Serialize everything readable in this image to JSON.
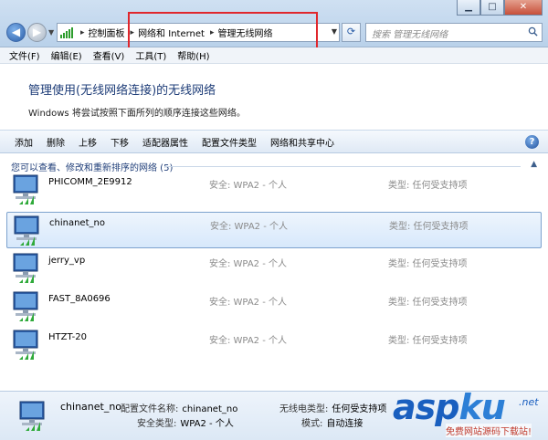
{
  "window": {
    "minimize": "▁",
    "maximize": "□",
    "close": "✕"
  },
  "address": {
    "crumbs": [
      "控制面板",
      "网络和 Internet",
      "管理无线网络"
    ],
    "search_placeholder": "搜索 管理无线网络"
  },
  "menu": {
    "items": [
      "文件(F)",
      "编辑(E)",
      "查看(V)",
      "工具(T)",
      "帮助(H)"
    ]
  },
  "page": {
    "title": "管理使用(无线网络连接)的无线网络",
    "description": "Windows 将尝试按照下面所列的顺序连接这些网络。"
  },
  "commands": [
    "添加",
    "删除",
    "上移",
    "下移",
    "适配器属性",
    "配置文件类型",
    "网络和共享中心"
  ],
  "list": {
    "group_header": "您可以查看、修改和重新排序的网络 (5)",
    "networks": [
      {
        "name": "PHICOMM_2E9912",
        "security": "安全: WPA2 - 个人",
        "type": "类型: 任何受支持项",
        "selected": false
      },
      {
        "name": "chinanet_no",
        "security": "安全: WPA2 - 个人",
        "type": "类型: 任何受支持项",
        "selected": true
      },
      {
        "name": "jerry_vp",
        "security": "安全: WPA2 - 个人",
        "type": "类型: 任何受支持项",
        "selected": false
      },
      {
        "name": "FAST_8A0696",
        "security": "安全: WPA2 - 个人",
        "type": "类型: 任何受支持项",
        "selected": false
      },
      {
        "name": "HTZT-20",
        "security": "安全: WPA2 - 个人",
        "type": "类型: 任何受支持项",
        "selected": false
      }
    ]
  },
  "details": {
    "name": "chinanet_no",
    "profile_label": "配置文件名称:",
    "profile_value": "chinanet_no",
    "security_label": "安全类型:",
    "security_value": "WPA2 - 个人",
    "radio_label": "无线电类型:",
    "radio_value": "任何受支持项",
    "mode_label": "模式:",
    "mode_value": "自动连接"
  },
  "watermark": {
    "asp": "asp",
    "ku": "ku",
    "dotnet": ".net",
    "subtitle": "免费网站源码下载站!"
  },
  "colors": {
    "accent": "#1e3d78",
    "highlight_box": "#e0262c",
    "selected_row": "#d7e8fb"
  }
}
